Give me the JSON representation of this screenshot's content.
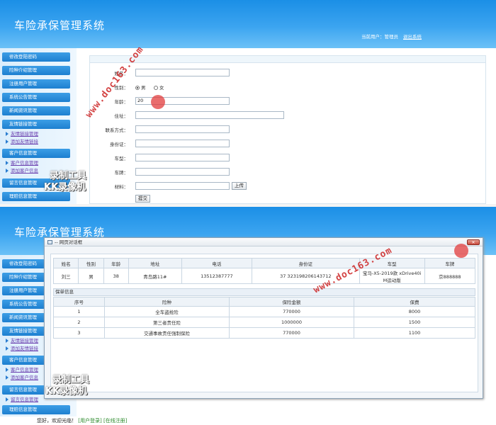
{
  "app": {
    "title": "车险承保管理系统",
    "user_label": "当前用户：",
    "user_name": "管理员",
    "logout": "退出系统"
  },
  "sidebar": {
    "items": [
      "修改登陆密码",
      "险种介绍管理",
      "注册用户管理",
      "系统公告管理",
      "新闻资讯管理",
      "友情链接管理"
    ],
    "sub1": [
      "友情链接管理",
      "添加友情链接"
    ],
    "item_customer": "客户信息管理",
    "sub2": [
      "客户信息管理",
      "添加客户信息"
    ],
    "item_msg": "留言信息管理",
    "item_claim": "理赔信息管理",
    "sub3": [
      "留言信息管理"
    ]
  },
  "form": {
    "labels": [
      "姓名：",
      "性别：",
      "年龄：",
      "住址：",
      "联系方式：",
      "身份证：",
      "车型：",
      "车牌：",
      "材料："
    ],
    "gender_male": "男",
    "gender_female": "女",
    "age_value": "20",
    "upload": "上传",
    "submit": "提交"
  },
  "dialog": {
    "title": "-- 网页对话框",
    "headers": [
      "姓名",
      "性别",
      "年龄",
      "地址",
      "电话",
      "身份证",
      "车型",
      "车牌"
    ],
    "row": [
      "刘三",
      "男",
      "38",
      "青岛路11#",
      "13512387777",
      "37 323198206143712",
      "宝马-X5-2019款 xDrive40i M运动版",
      "京888888"
    ],
    "policy_title": "保单信息",
    "policy_headers": [
      "序号",
      "险种",
      "保险金额",
      "保费"
    ],
    "policies": [
      [
        "1",
        "全车盗抢险",
        "770000",
        "8000"
      ],
      [
        "2",
        "第三者责任险",
        "1000000",
        "1500"
      ],
      [
        "3",
        "交通事故责任强制保险",
        "770000",
        "1100"
      ]
    ]
  },
  "watermark": {
    "site": "www.doc163.com",
    "tool1": "录制工具",
    "tool2": "KK录像机"
  },
  "footer": {
    "greet": "您好，欢迎光临！",
    "login": "[用户登录]",
    "register": "[在线注册]"
  }
}
